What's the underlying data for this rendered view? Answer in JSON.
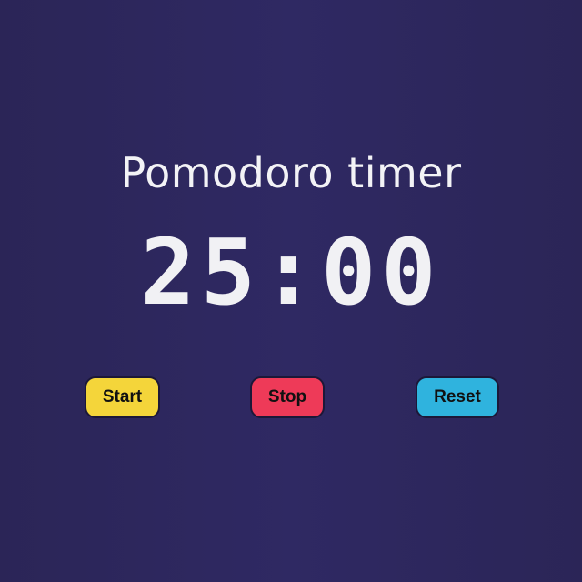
{
  "app": {
    "title": "Pomodoro timer",
    "time_display": "25:00"
  },
  "controls": {
    "start_label": "Start",
    "stop_label": "Stop",
    "reset_label": "Reset"
  },
  "colors": {
    "background": "#2d275e",
    "start": "#f4d53a",
    "stop": "#ee3a58",
    "reset": "#2fb3de",
    "text": "#f1f1f4"
  }
}
